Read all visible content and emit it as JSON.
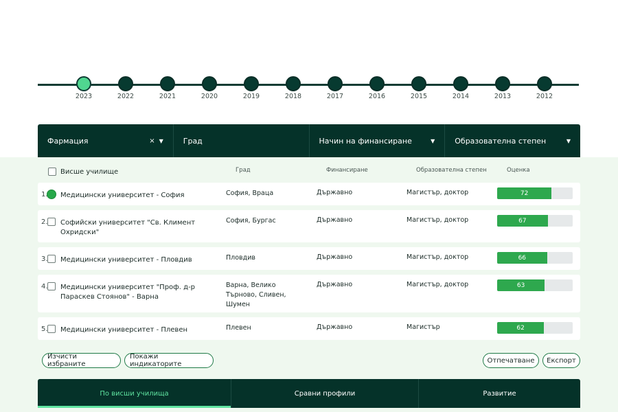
{
  "timeline": {
    "years": [
      "2023",
      "2022",
      "2021",
      "2020",
      "2019",
      "2018",
      "2017",
      "2016",
      "2015",
      "2014",
      "2013",
      "2012"
    ],
    "active": "2023"
  },
  "filters": {
    "specialty": "Фармация",
    "specialty_clear": "×",
    "city": "Град",
    "financing": "Начин на финансиране",
    "degree": "Образователна степен"
  },
  "table": {
    "headers": {
      "school": "Висше училище",
      "city": "Град",
      "financing": "Финансиране",
      "degree": "Образователна степен",
      "score": "Оценка"
    },
    "rows": [
      {
        "num": "1.",
        "name": "Медицински университет - София",
        "city": "София, Враца",
        "financing": "Държавно",
        "degree": "Магистър, доктор",
        "score": "72",
        "score_value": 72
      },
      {
        "num": "2.",
        "name": "Софийски университет \"Св. Климент Охридски\"",
        "city": "София, Бургас",
        "financing": "Държавно",
        "degree": "Магистър, доктор",
        "score": "67",
        "score_value": 67
      },
      {
        "num": "3.",
        "name": "Медицински университет - Пловдив",
        "city": "Пловдив",
        "financing": "Държавно",
        "degree": "Магистър, доктор",
        "score": "66",
        "score_value": 66
      },
      {
        "num": "4.",
        "name": "Медицински университет \"Проф. д-р Параскев Стоянов\" - Варна",
        "city": "Варна, Велико Търново, Сливен, Шумен",
        "financing": "Държавно",
        "degree": "Магистър, доктор",
        "score": "63",
        "score_value": 63
      },
      {
        "num": "5.",
        "name": "Медицински университет - Плевен",
        "city": "Плевен",
        "financing": "Държавно",
        "degree": "Магистър",
        "score": "62",
        "score_value": 62
      }
    ]
  },
  "actions": {
    "clear_selected": "Изчисти избраните",
    "show_indicators": "Покажи индикаторите",
    "print": "Отпечатване",
    "export": "Експорт"
  },
  "tabs": {
    "by_school": "По висши училища",
    "compare": "Сравни профили",
    "development": "Развитие"
  },
  "colors": {
    "dark_green": "#053229",
    "accent_green": "#50d690",
    "bar_green": "#2ea84e",
    "light_bg": "#eff8ef"
  }
}
